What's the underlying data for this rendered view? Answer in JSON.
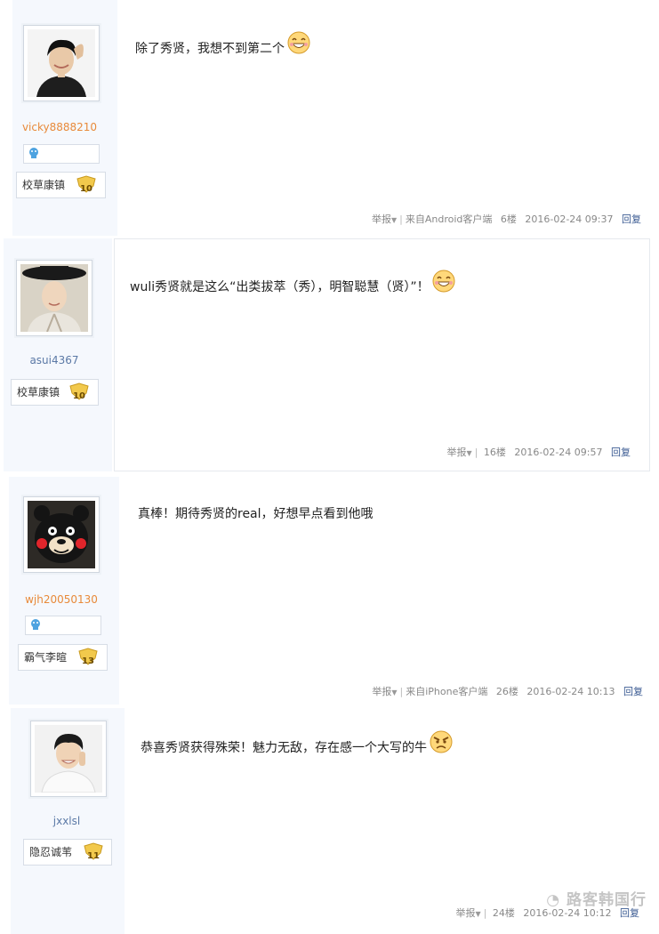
{
  "posts": [
    {
      "username": "vicky8888210",
      "username_color": "#e88a3a",
      "has_gem_row": true,
      "medal_label": "校草康镇",
      "medal_level": "10",
      "content": "除了秀贤，我想不到第二个",
      "emoji": "grin-emoji",
      "report": "举报",
      "source": "来自Android客户端",
      "floor": "6楼",
      "timestamp": "2016-02-24 09:37",
      "reply": "回复"
    },
    {
      "username": "asui4367",
      "username_color": "#5b79a6",
      "has_gem_row": false,
      "medal_label": "校草康镇",
      "medal_level": "10",
      "content": "wuli秀贤就是这么“出类拔萃（秀），明智聪慧（贤）”！",
      "emoji": "grin-emoji",
      "report": "举报",
      "source": "",
      "floor": "16楼",
      "timestamp": "2016-02-24 09:57",
      "reply": "回复"
    },
    {
      "username": "wjh20050130",
      "username_color": "#e88a3a",
      "has_gem_row": true,
      "medal_label": "霸气李暄",
      "medal_level": "13",
      "content": "真棒！期待秀贤的real，好想早点看到他哦",
      "emoji": "",
      "report": "举报",
      "source": "来自iPhone客户端",
      "floor": "26楼",
      "timestamp": "2016-02-24 10:13",
      "reply": "回复"
    },
    {
      "username": "jxxlsl",
      "username_color": "#5b79a6",
      "has_gem_row": false,
      "medal_label": "隐忍诚苇",
      "medal_level": "11",
      "content": "恭喜秀贤获得殊荣！魅力无敌，存在感一个大写的牛",
      "emoji": "angry-emoji",
      "report": "举报",
      "source": "",
      "floor": "24楼",
      "timestamp": "2016-02-24 10:12",
      "reply": "回复"
    }
  ],
  "watermark": "路客韩国行",
  "colors": {
    "sidebar_bg": "#f5f8fd",
    "reply_link": "#3a5a92",
    "medal_gold": "#f2c94c"
  }
}
